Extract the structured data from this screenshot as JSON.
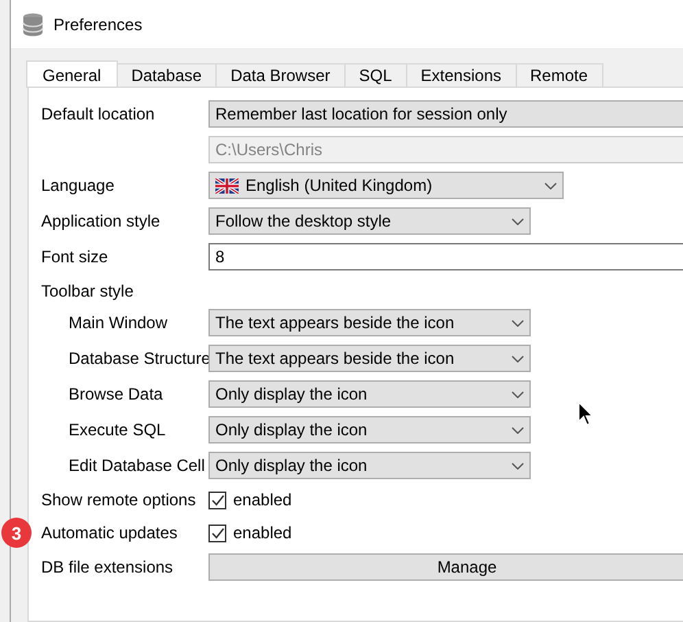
{
  "window": {
    "title": "Preferences"
  },
  "tabs": [
    {
      "label": "General",
      "selected": true
    },
    {
      "label": "Database",
      "selected": false
    },
    {
      "label": "Data Browser",
      "selected": false
    },
    {
      "label": "SQL",
      "selected": false
    },
    {
      "label": "Extensions",
      "selected": false
    },
    {
      "label": "Remote",
      "selected": false
    }
  ],
  "settings": [
    {
      "kind": "wide_combo",
      "label": "Default location",
      "value": "Remember last location for session only"
    },
    {
      "kind": "path",
      "value": "C:\\Users\\Chris",
      "disabled": true
    },
    {
      "kind": "combo",
      "label": "Language",
      "value": "English (United Kingdom)",
      "flag": true
    },
    {
      "kind": "combo",
      "label": "Application style",
      "value": "Follow the desktop style"
    },
    {
      "kind": "field",
      "label": "Font size",
      "value": "8"
    },
    {
      "kind": "section",
      "label": "Toolbar style"
    },
    {
      "kind": "combo",
      "label": "Main Window",
      "value": "The text appears beside the icon",
      "indent": true
    },
    {
      "kind": "combo",
      "label": "Database Structure",
      "value": "The text appears beside the icon",
      "indent": true
    },
    {
      "kind": "combo",
      "label": "Browse Data",
      "value": "Only display the icon",
      "indent": true
    },
    {
      "kind": "combo",
      "label": "Execute SQL",
      "value": "Only display the icon",
      "indent": true
    },
    {
      "kind": "combo",
      "label": "Edit Database Cell",
      "value": "Only display the icon",
      "indent": true
    },
    {
      "kind": "checkbox",
      "label": "Show remote options",
      "text": "enabled",
      "checked": true
    },
    {
      "kind": "checkbox",
      "label": "Automatic updates",
      "text": "enabled",
      "checked": true,
      "badge": "3"
    },
    {
      "kind": "button",
      "label": "DB file extensions",
      "text": "Manage"
    }
  ]
}
